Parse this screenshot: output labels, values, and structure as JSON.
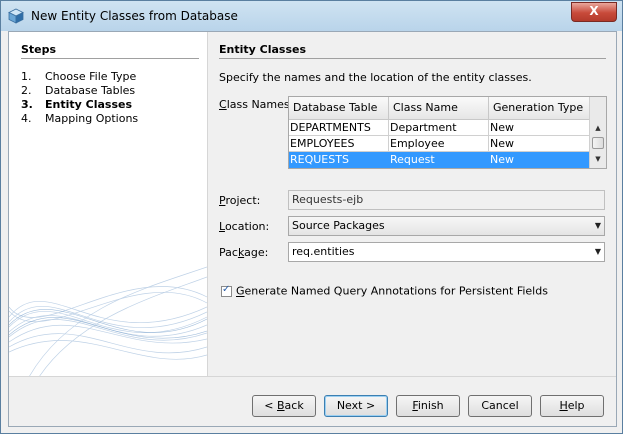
{
  "window": {
    "title": "New Entity Classes from Database",
    "close_label": "X"
  },
  "steps": {
    "title": "Steps",
    "items": [
      {
        "num": "1.",
        "label": "Choose File Type"
      },
      {
        "num": "2.",
        "label": "Database Tables"
      },
      {
        "num": "3.",
        "label": "Entity Classes",
        "current": true
      },
      {
        "num": "4.",
        "label": "Mapping Options"
      }
    ]
  },
  "content": {
    "title": "Entity Classes",
    "description": "Specify the names and the location of the entity classes.",
    "class_names_label_pre": "",
    "class_names_label_u": "C",
    "class_names_label_post": "lass Names:",
    "table": {
      "headers": [
        "Database Table",
        "Class Name",
        "Generation Type"
      ],
      "rows": [
        [
          "DEPARTMENTS",
          "Department",
          "New"
        ],
        [
          "EMPLOYEES",
          "Employee",
          "New"
        ],
        [
          "REQUESTS",
          "Request",
          "New"
        ]
      ],
      "selected_row": 2
    },
    "project": {
      "label_u": "P",
      "label_post": "roject:",
      "value": "Requests-ejb"
    },
    "location": {
      "label_u": "L",
      "label_post": "ocation:",
      "value": "Source Packages"
    },
    "package": {
      "label_pre": "Pac",
      "label_u": "k",
      "label_post": "age:",
      "value": "req.entities"
    },
    "checkbox": {
      "label_u": "G",
      "label_post": "enerate Named Query Annotations for Persistent Fields",
      "checked": true
    }
  },
  "buttons": {
    "back": "< Back",
    "back_pre": "< ",
    "back_u": "B",
    "back_post": "ack",
    "next": "Next >",
    "finish_u": "F",
    "finish_post": "inish",
    "cancel": "Cancel",
    "help_u": "H",
    "help_post": "elp"
  },
  "colors": {
    "selection": "#3399ff",
    "title_bar": "#b9d4ea",
    "close": "#c84a3a"
  },
  "icons": {
    "title": "netbeans-cube-icon",
    "close": "close-icon",
    "combo": "chevron-down-icon",
    "check": "checkmark-icon"
  }
}
